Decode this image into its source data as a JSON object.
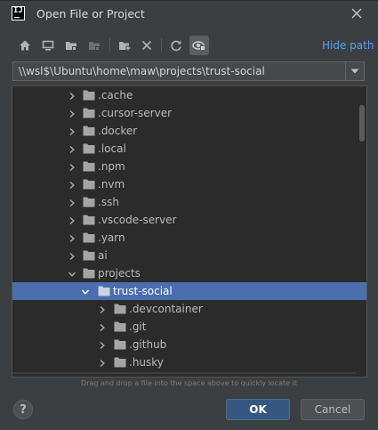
{
  "window": {
    "title": "Open File or Project",
    "app_icon_text": "IJ"
  },
  "toolbar": {
    "buttons": [
      "home-icon",
      "desktop-icon",
      "project-folder-icon",
      "module-folder-icon",
      "new-folder-icon",
      "delete-icon",
      "refresh-icon",
      "show-hidden-icon"
    ],
    "hide_path_label": "Hide path"
  },
  "path": {
    "value": "\\\\wsl$\\Ubuntu\\home\\maw\\projects\\trust-social"
  },
  "tree": {
    "items": [
      {
        "label": ".cache",
        "depth": 0,
        "expanded": false,
        "selected": false
      },
      {
        "label": ".cursor-server",
        "depth": 0,
        "expanded": false,
        "selected": false
      },
      {
        "label": ".docker",
        "depth": 0,
        "expanded": false,
        "selected": false
      },
      {
        "label": ".local",
        "depth": 0,
        "expanded": false,
        "selected": false
      },
      {
        "label": ".npm",
        "depth": 0,
        "expanded": false,
        "selected": false
      },
      {
        "label": ".nvm",
        "depth": 0,
        "expanded": false,
        "selected": false
      },
      {
        "label": ".ssh",
        "depth": 0,
        "expanded": false,
        "selected": false
      },
      {
        "label": ".vscode-server",
        "depth": 0,
        "expanded": false,
        "selected": false
      },
      {
        "label": ".yarn",
        "depth": 0,
        "expanded": false,
        "selected": false
      },
      {
        "label": "ai",
        "depth": 0,
        "expanded": false,
        "selected": false
      },
      {
        "label": "projects",
        "depth": 0,
        "expanded": true,
        "selected": false
      },
      {
        "label": "trust-social",
        "depth": 1,
        "expanded": true,
        "selected": true
      },
      {
        "label": ".devcontainer",
        "depth": 2,
        "expanded": false,
        "selected": false
      },
      {
        "label": ".git",
        "depth": 2,
        "expanded": false,
        "selected": false
      },
      {
        "label": ".github",
        "depth": 2,
        "expanded": false,
        "selected": false
      },
      {
        "label": ".husky",
        "depth": 2,
        "expanded": false,
        "selected": false
      }
    ]
  },
  "hint": "Drag and drop a file into the space above to quickly locate it",
  "buttons": {
    "help": "?",
    "ok": "OK",
    "cancel": "Cancel"
  },
  "colors": {
    "dialog_bg": "#3c3f41",
    "tree_bg": "#2b2b2b",
    "selection": "#4b6eaf",
    "link": "#589df6",
    "default_button": "#365880"
  }
}
